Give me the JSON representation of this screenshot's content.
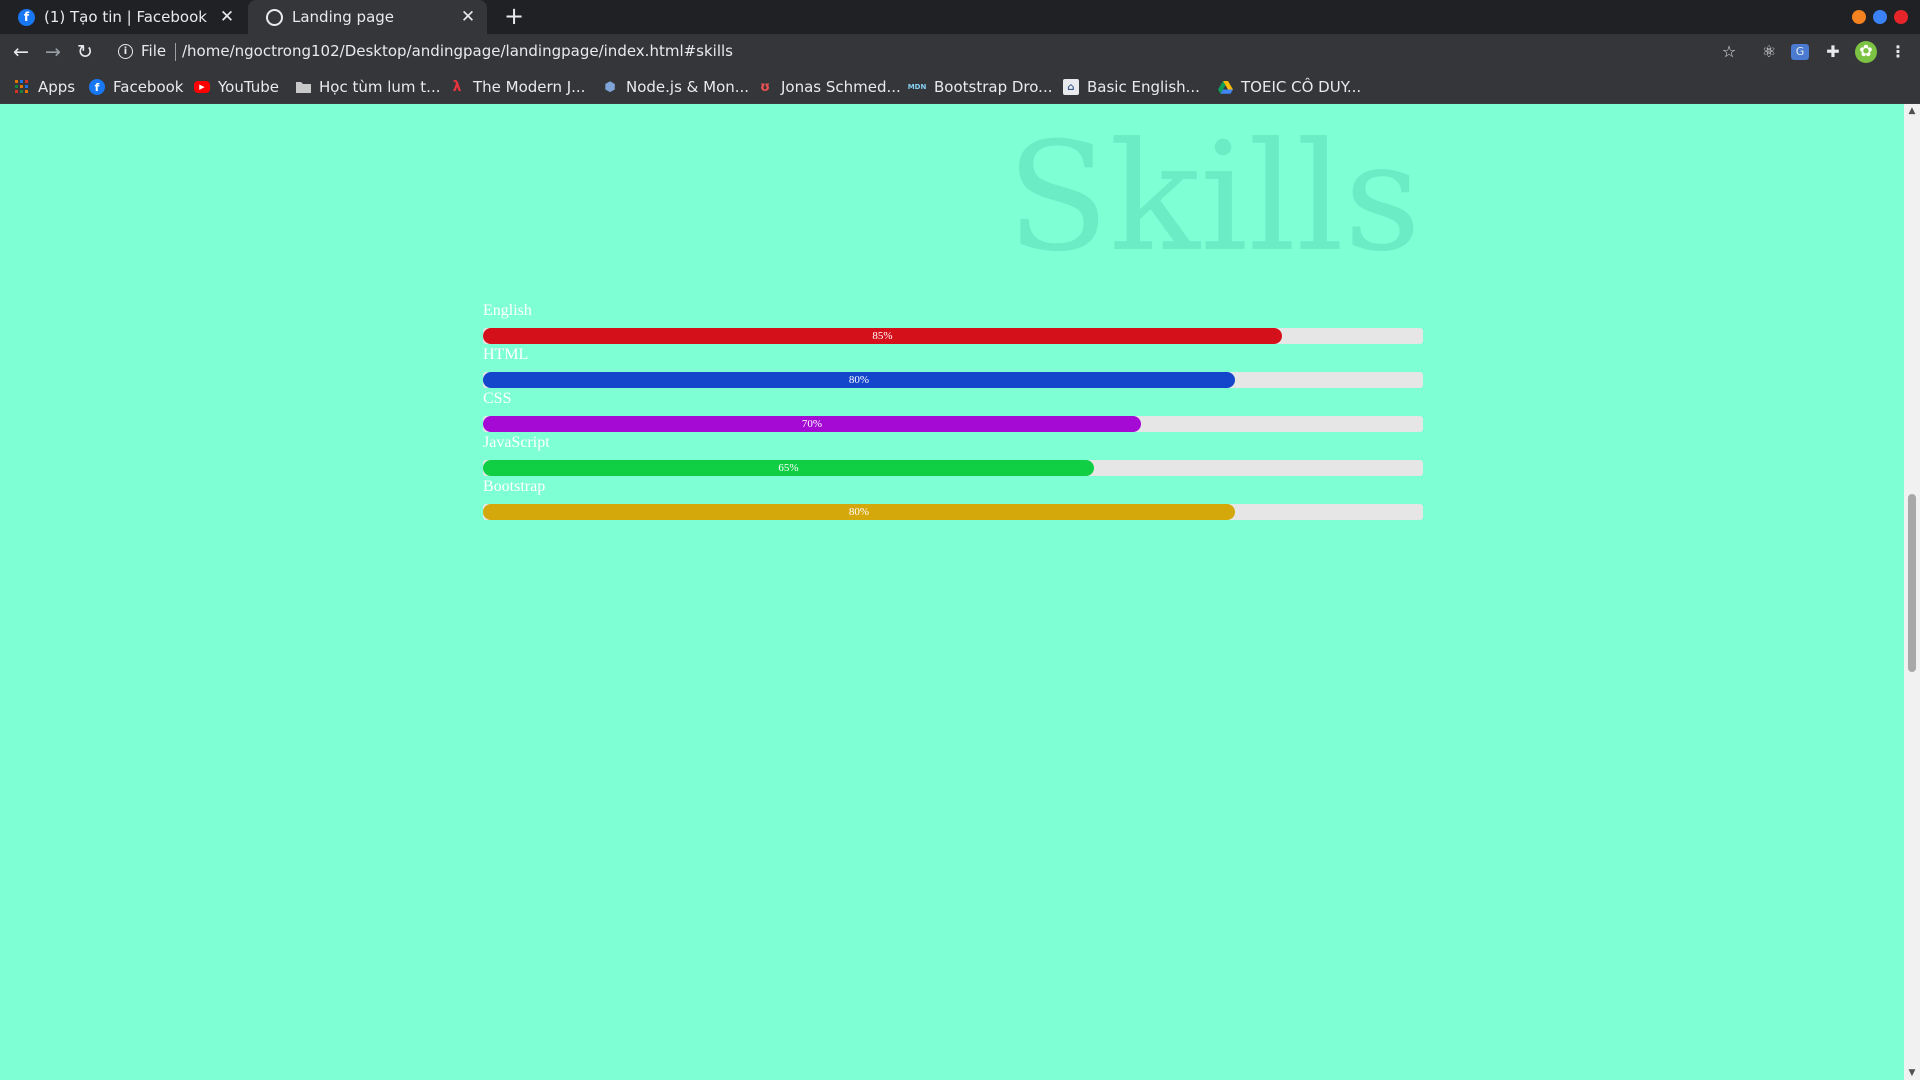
{
  "browser": {
    "tabs": [
      {
        "title": "(1) Tạo tin | Facebook",
        "icon": "facebook-icon",
        "active": false
      },
      {
        "title": "Landing page",
        "icon": "globe-icon",
        "active": true
      }
    ],
    "address": {
      "scheme_label": "File",
      "url": "/home/ngoctrong102/Desktop/andingpage/landingpage/index.html#skills"
    },
    "window_dot_colors": [
      "#f58220",
      "#3b82f6",
      "#e5252a"
    ],
    "bookmarks": [
      {
        "label": "Apps",
        "icon": "apps-grid-icon"
      },
      {
        "label": "Facebook",
        "icon": "facebook-icon"
      },
      {
        "label": "YouTube",
        "icon": "youtube-icon"
      },
      {
        "label": "Học tùm lum t...",
        "icon": "folder-icon"
      },
      {
        "label": "The Modern J...",
        "icon": "modern-js-icon"
      },
      {
        "label": "Node.js & Mon...",
        "icon": "node-icon"
      },
      {
        "label": "Jonas Schmed...",
        "icon": "udemy-icon"
      },
      {
        "label": "Bootstrap Dro...",
        "icon": "mdn-icon"
      },
      {
        "label": "Basic English...",
        "icon": "school-icon"
      },
      {
        "label": "TOEIC CÔ DUY...",
        "icon": "google-drive-icon"
      }
    ]
  },
  "page": {
    "heading": "Skills",
    "skills": [
      {
        "name": "English",
        "label": "85%",
        "percent": 85,
        "color": "#d4111a"
      },
      {
        "name": "HTML",
        "label": "80%",
        "percent": 80,
        "color": "#1446cc"
      },
      {
        "name": "CSS",
        "label": "70%",
        "percent": 70,
        "color": "#a40ad4"
      },
      {
        "name": "JavaScript",
        "label": "65%",
        "percent": 65,
        "color": "#11cf45"
      },
      {
        "name": "Bootstrap",
        "label": "80%",
        "percent": 80,
        "color": "#d4a80b"
      }
    ]
  }
}
